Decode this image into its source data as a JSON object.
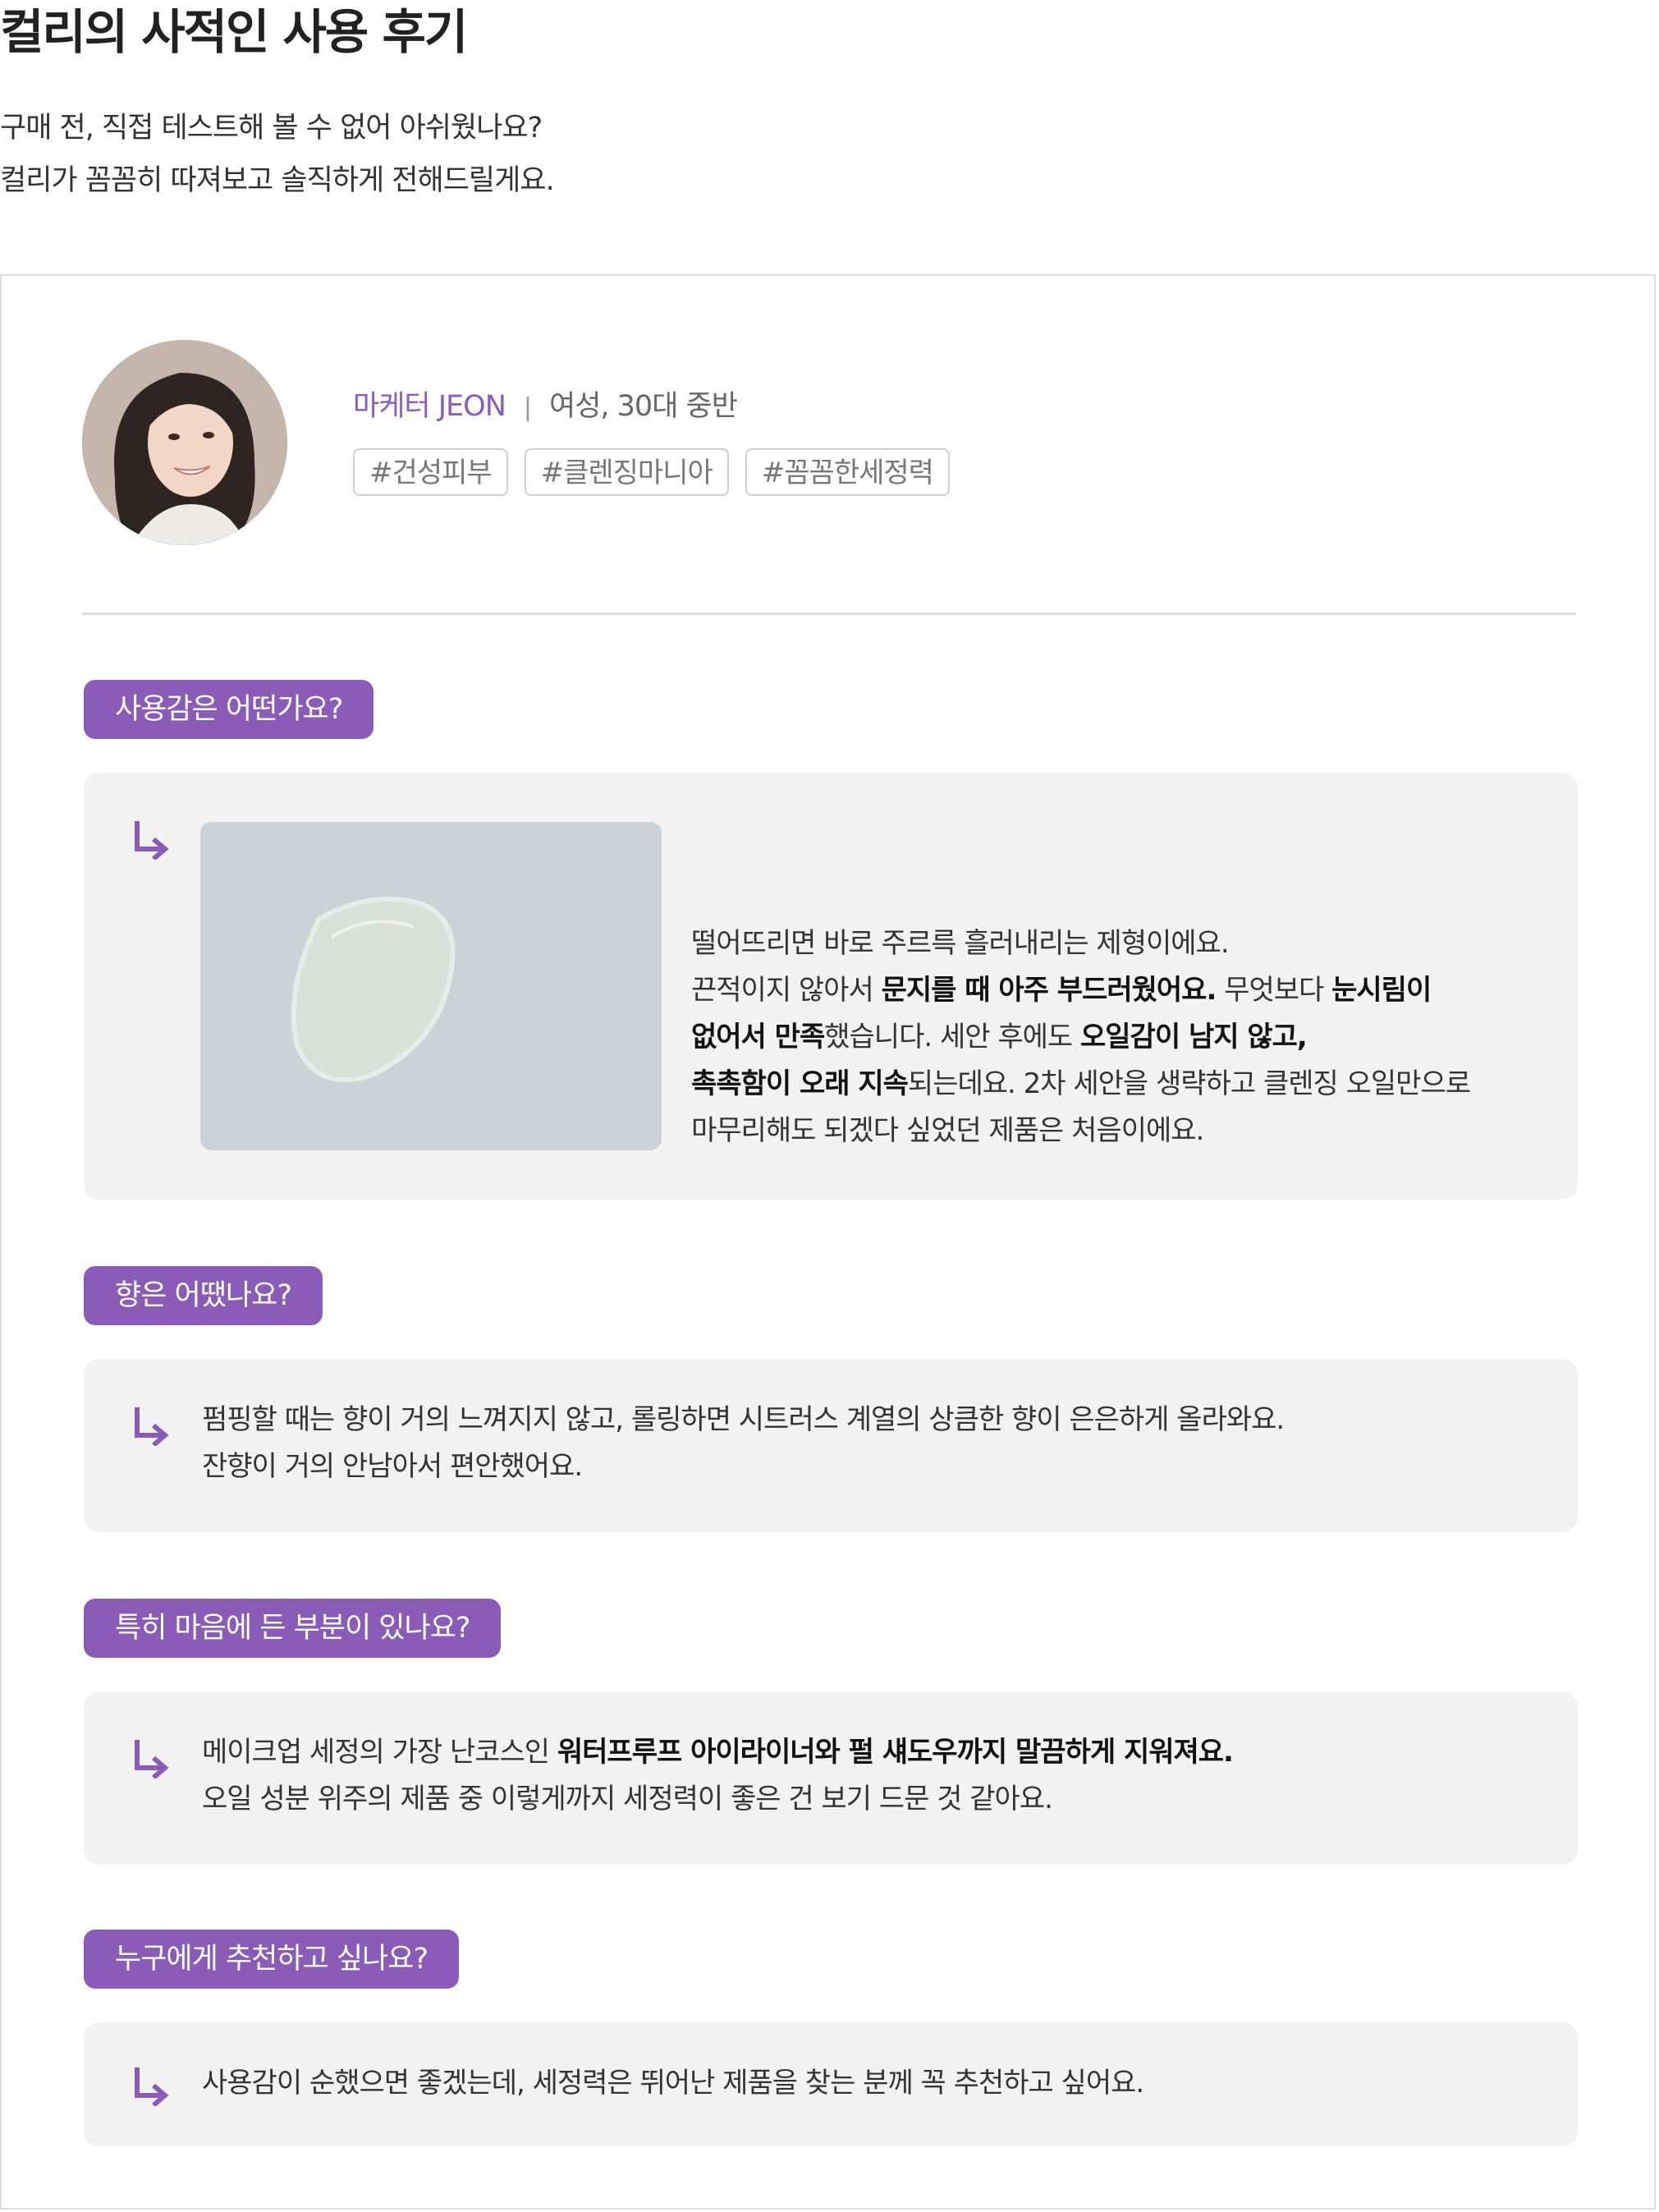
{
  "header": {
    "title": "컬리의 사적인 사용 후기",
    "intro_lines": [
      "구매 전, 직접 테스트해 볼 수 없어 아쉬웠나요?",
      "컬리가 꼼꼼히 따져보고 솔직하게 전해드릴게요."
    ]
  },
  "reviewer": {
    "name": "마케터 JEON",
    "separator": "|",
    "meta": "여성, 30대 중반",
    "tags": [
      "#건성피부",
      "#클렌징마니아",
      "#꼼꼼한세정력"
    ]
  },
  "icons": {
    "answer_marker": "arrow-down-right-icon",
    "avatar": "person-photo",
    "product": "oil-drop-photo"
  },
  "colors": {
    "accent": "#8a5cb8",
    "answer_bg": "#f2f2f2",
    "border": "#dddddd"
  },
  "sections": [
    {
      "question": "사용감은 어떤가요?",
      "answer": [
        [
          "떨어뜨리면 바로 주르륵 흘러내리는 제형이에요."
        ],
        [
          "끈적이지 않아서 ",
          "문지를 때 아주 부드러웠어요.",
          " 무엇보다 ",
          "눈시림이"
        ],
        [
          "없어서 만족",
          "했습니다. 세안 후에도 ",
          "오일감이 남지 않고,"
        ],
        [
          "촉촉함이 오래 지속",
          "되는데요. 2차 세안을 생략하고 클렌징 오일만으로"
        ],
        [
          "마무리해도 되겠다 싶었던 제품은 처음이에요."
        ]
      ]
    },
    {
      "question": "향은 어땠나요?",
      "answer": [
        [
          "펌핑할 때는 향이 거의 느껴지지 않고, 롤링하면 시트러스 계열의 상큼한 향이 은은하게 올라와요."
        ],
        [
          "잔향이 거의 안남아서 편안했어요."
        ]
      ]
    },
    {
      "question": "특히 마음에 든 부분이 있나요?",
      "answer": [
        [
          "메이크업 세정의 가장 난코스인 ",
          "워터프루프 아이라이너와 펄 섀도우까지 말끔하게 지워져요."
        ],
        [
          "오일 성분 위주의 제품 중 이렇게까지 세정력이 좋은 건 보기 드문 것 같아요."
        ]
      ]
    },
    {
      "question": "누구에게 추천하고 싶나요?",
      "answer": [
        [
          "사용감이 순했으면 좋겠는데, 세정력은 뛰어난 제품을 찾는 분께 꼭 추천하고 싶어요."
        ]
      ]
    }
  ]
}
